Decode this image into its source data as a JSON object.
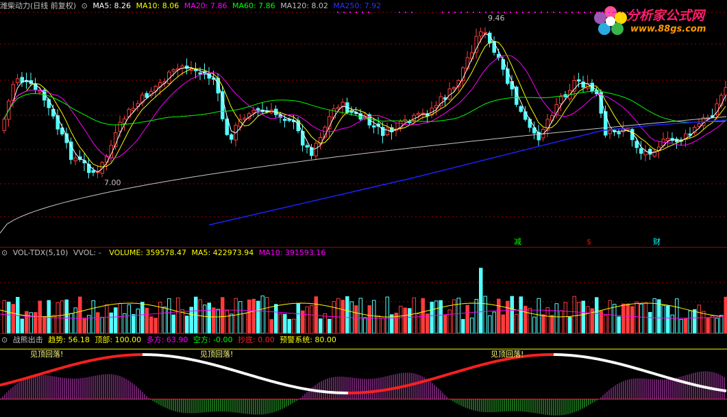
{
  "main": {
    "title": "潍柴动力(日线 前复权)",
    "ma": [
      {
        "label": "MA5: 8.26",
        "color": "#ffffff"
      },
      {
        "label": "MA10: 8.06",
        "color": "#ffff00"
      },
      {
        "label": "MA20: 7.86",
        "color": "#ff00ff"
      },
      {
        "label": "MA60: 7.86",
        "color": "#00ff00"
      },
      {
        "label": "MA120: 8.02",
        "color": "#c0c0c0"
      },
      {
        "label": "MA250: 7.92",
        "color": "#0000ff"
      }
    ],
    "high_label": "9.46",
    "low_label": "7.00",
    "markers": [
      {
        "text": "减",
        "color": "#00ff00"
      },
      {
        "text": "$",
        "color": "#ff0000"
      },
      {
        "text": "财",
        "color": "#00ffff"
      }
    ]
  },
  "volume": {
    "name": "VOL-TDX(5,10)",
    "vvol": "VVOL: -",
    "volume": "VOLUME: 359578.47",
    "ma5": "MA5: 422973.94",
    "ma10": "MA10: 391593.16"
  },
  "indicator": {
    "name": "战熊出击",
    "items": [
      {
        "label": "趋势: 56.18",
        "color": "#ffff00"
      },
      {
        "label": "顶部: 100.00",
        "color": "#ffff00"
      },
      {
        "label": "多方: 63.90",
        "color": "#ff00ff"
      },
      {
        "label": "空方: -0.00",
        "color": "#00ff00"
      },
      {
        "label": "抄底: 0.00",
        "color": "#ff0000"
      },
      {
        "label": "预警系统: 80.00",
        "color": "#ffff00"
      }
    ],
    "signals": [
      "见顶回落!",
      "见顶回落!",
      "见顶回落!"
    ]
  },
  "logo": {
    "name": "分析家公式网",
    "url": "www.88gs.com"
  },
  "colors": {
    "up": "#ff3c3c",
    "down": "#54ffff",
    "grid": "#a00000"
  }
}
